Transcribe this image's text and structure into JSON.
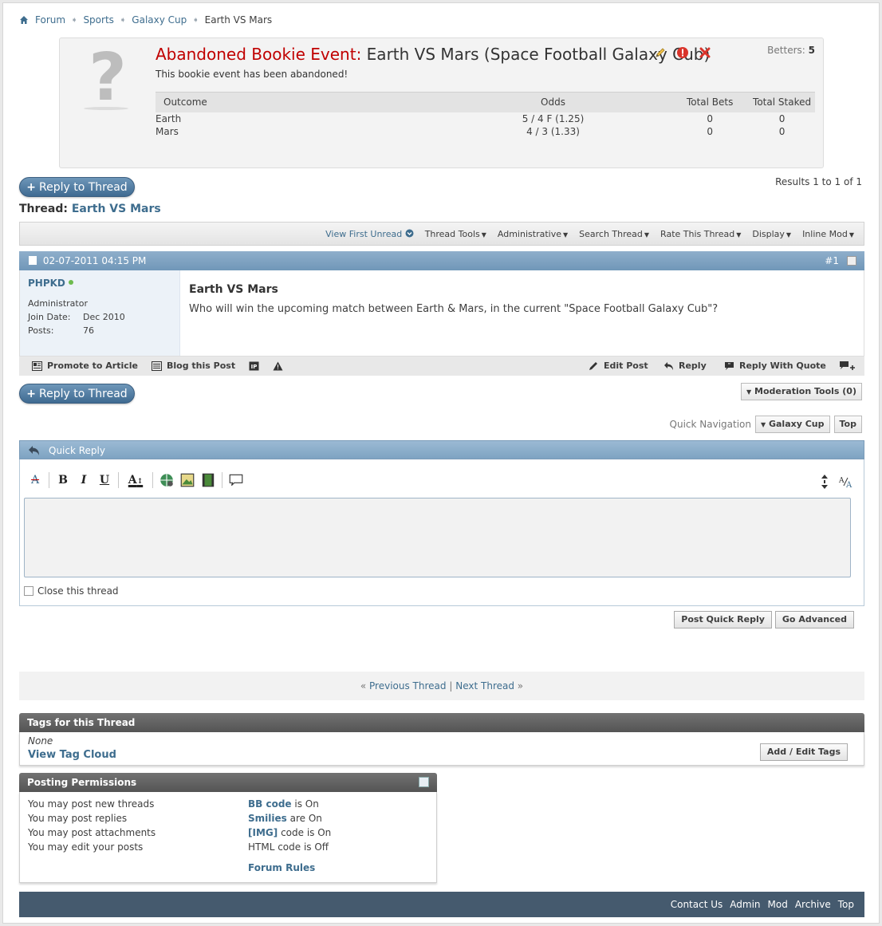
{
  "breadcrumb": {
    "items": [
      "Forum",
      "Sports",
      "Galaxy Cup"
    ],
    "current": "Earth VS Mars"
  },
  "bookie": {
    "status_label": "Abandoned Bookie Event:",
    "event_title": "Earth VS Mars (Space Football Galaxy Cub)",
    "betters_label": "Betters:",
    "betters_count": "5",
    "subtitle": "This bookie event has been abandoned!",
    "columns": [
      "Outcome",
      "Odds",
      "Total Bets",
      "Total Staked"
    ],
    "rows": [
      {
        "outcome": "Earth",
        "odds": "5 / 4 F (1.25)",
        "bets": "0",
        "staked": "0"
      },
      {
        "outcome": "Mars",
        "odds": "4 / 3 (1.33)",
        "bets": "0",
        "staked": "0"
      }
    ]
  },
  "reply_to_thread_label": "Reply to Thread",
  "results_text": "Results 1 to 1 of 1",
  "thread": {
    "label": "Thread:",
    "title": "Earth VS Mars"
  },
  "toolbar": {
    "view_first_unread": "View First Unread",
    "thread_tools": "Thread Tools",
    "administrative": "Administrative",
    "search_thread": "Search Thread",
    "rate_thread": "Rate This Thread",
    "display": "Display",
    "inline_mod": "Inline Mod"
  },
  "post": {
    "date": "02-07-2011 04:15 PM",
    "number": "#1",
    "username": "PHPKD",
    "role": "Administrator",
    "join_label": "Join Date:",
    "join_date": "Dec 2010",
    "posts_label": "Posts:",
    "posts_count": "76",
    "title": "Earth VS Mars",
    "text": "Who will win the upcoming match between Earth & Mars, in the current \"Space Football Galaxy Cub\"?",
    "actions": {
      "promote": "Promote to Article",
      "blog": "Blog this Post",
      "edit": "Edit Post",
      "reply": "Reply",
      "reply_quote": "Reply With Quote"
    }
  },
  "moderation_tools": "Moderation Tools (0)",
  "quick_nav": {
    "label": "Quick Navigation",
    "forum": "Galaxy Cup",
    "top": "Top"
  },
  "quick_reply": {
    "title": "Quick Reply",
    "close_thread_label": "Close this thread",
    "post_button": "Post Quick Reply",
    "advanced_button": "Go Advanced"
  },
  "prevnext": {
    "prev": "Previous Thread",
    "next": "Next Thread",
    "separator": "|"
  },
  "tags": {
    "title": "Tags for this Thread",
    "none": "None",
    "cloud": "View Tag Cloud",
    "edit_button": "Add / Edit Tags"
  },
  "permissions": {
    "title": "Posting Permissions",
    "left": [
      "You may post new threads",
      "You may post replies",
      "You may post attachments",
      "You may edit your posts"
    ],
    "bbcode_link": "BB code",
    "bbcode_state": "is On",
    "smilies_link": "Smilies",
    "smilies_state": "are On",
    "img_link": "[IMG]",
    "img_state": "code is On",
    "html_text": "HTML code is Off",
    "rules": "Forum Rules"
  },
  "footer": {
    "links": [
      "Contact Us",
      "Admin",
      "Mod",
      "Archive",
      "Top"
    ]
  }
}
